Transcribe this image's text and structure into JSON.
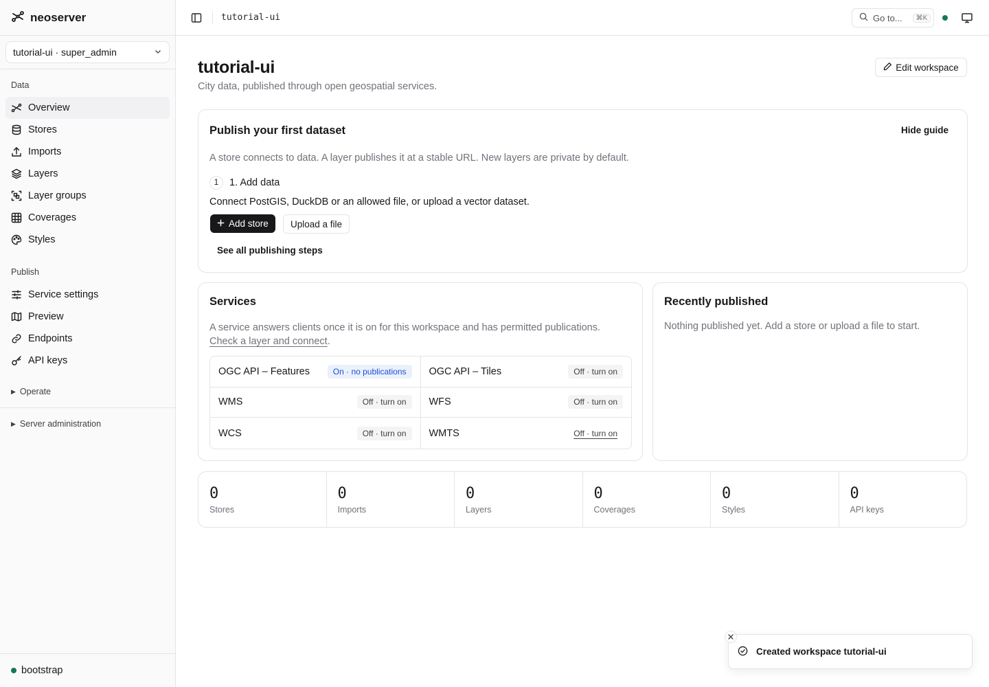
{
  "app": {
    "name": "neoserver"
  },
  "workspace_select": {
    "value": "tutorial-ui · super_admin"
  },
  "sidebar": {
    "groups": [
      {
        "label": "Data",
        "items": [
          {
            "label": "Overview",
            "icon": "overview-icon"
          },
          {
            "label": "Stores",
            "icon": "database-icon"
          },
          {
            "label": "Imports",
            "icon": "upload-icon"
          },
          {
            "label": "Layers",
            "icon": "layers-icon"
          },
          {
            "label": "Layer groups",
            "icon": "layer-groups-icon"
          },
          {
            "label": "Coverages",
            "icon": "grid-icon"
          },
          {
            "label": "Styles",
            "icon": "palette-icon"
          }
        ]
      },
      {
        "label": "Publish",
        "items": [
          {
            "label": "Service settings",
            "icon": "sliders-icon"
          },
          {
            "label": "Preview",
            "icon": "map-icon"
          },
          {
            "label": "Endpoints",
            "icon": "link-icon"
          },
          {
            "label": "API keys",
            "icon": "key-icon"
          }
        ]
      }
    ],
    "collapsed": [
      "Operate",
      "Server administration"
    ],
    "footer_status": "bootstrap"
  },
  "topbar": {
    "breadcrumb": "tutorial-ui",
    "goto_label": "Go to...",
    "goto_shortcut": "⌘K"
  },
  "page": {
    "title": "tutorial-ui",
    "subtitle": "City data, published through open geospatial services.",
    "edit_button": "Edit workspace"
  },
  "guide": {
    "title": "Publish your first dataset",
    "hide_label": "Hide guide",
    "description": "A store connects to data. A layer publishes it at a stable URL. New layers are private by default.",
    "step_number": "1",
    "step_title": "1. Add data",
    "step_description": "Connect PostGIS, DuckDB or an allowed file, or upload a vector dataset.",
    "primary_button": "Add store",
    "secondary_button": "Upload a file",
    "see_all": "See all publishing steps"
  },
  "services": {
    "title": "Services",
    "description": "A service answers clients once it is on for this workspace and has permitted publications.",
    "link": "Check a layer and connect",
    "link_suffix": ".",
    "items": [
      {
        "name": "OGC API – Features",
        "status": "On · no publications"
      },
      {
        "name": "OGC API – Tiles",
        "status": "Off · turn on"
      },
      {
        "name": "WMS",
        "status": "Off · turn on"
      },
      {
        "name": "WFS",
        "status": "Off · turn on"
      },
      {
        "name": "WCS",
        "status": "Off · turn on"
      },
      {
        "name": "WMTS",
        "status": "Off · turn on"
      }
    ]
  },
  "recent": {
    "title": "Recently published",
    "empty_text": "Nothing published yet. Add a store or upload a file to start."
  },
  "stats": [
    {
      "value": "0",
      "label": "Stores"
    },
    {
      "value": "0",
      "label": "Imports"
    },
    {
      "value": "0",
      "label": "Layers"
    },
    {
      "value": "0",
      "label": "Coverages"
    },
    {
      "value": "0",
      "label": "Styles"
    },
    {
      "value": "0",
      "label": "API keys"
    }
  ],
  "toast": {
    "message": "Created workspace tutorial-ui"
  },
  "colors": {
    "accent": "#18181b",
    "status_green": "#16794f",
    "on_badge": "#1d4ed8"
  }
}
